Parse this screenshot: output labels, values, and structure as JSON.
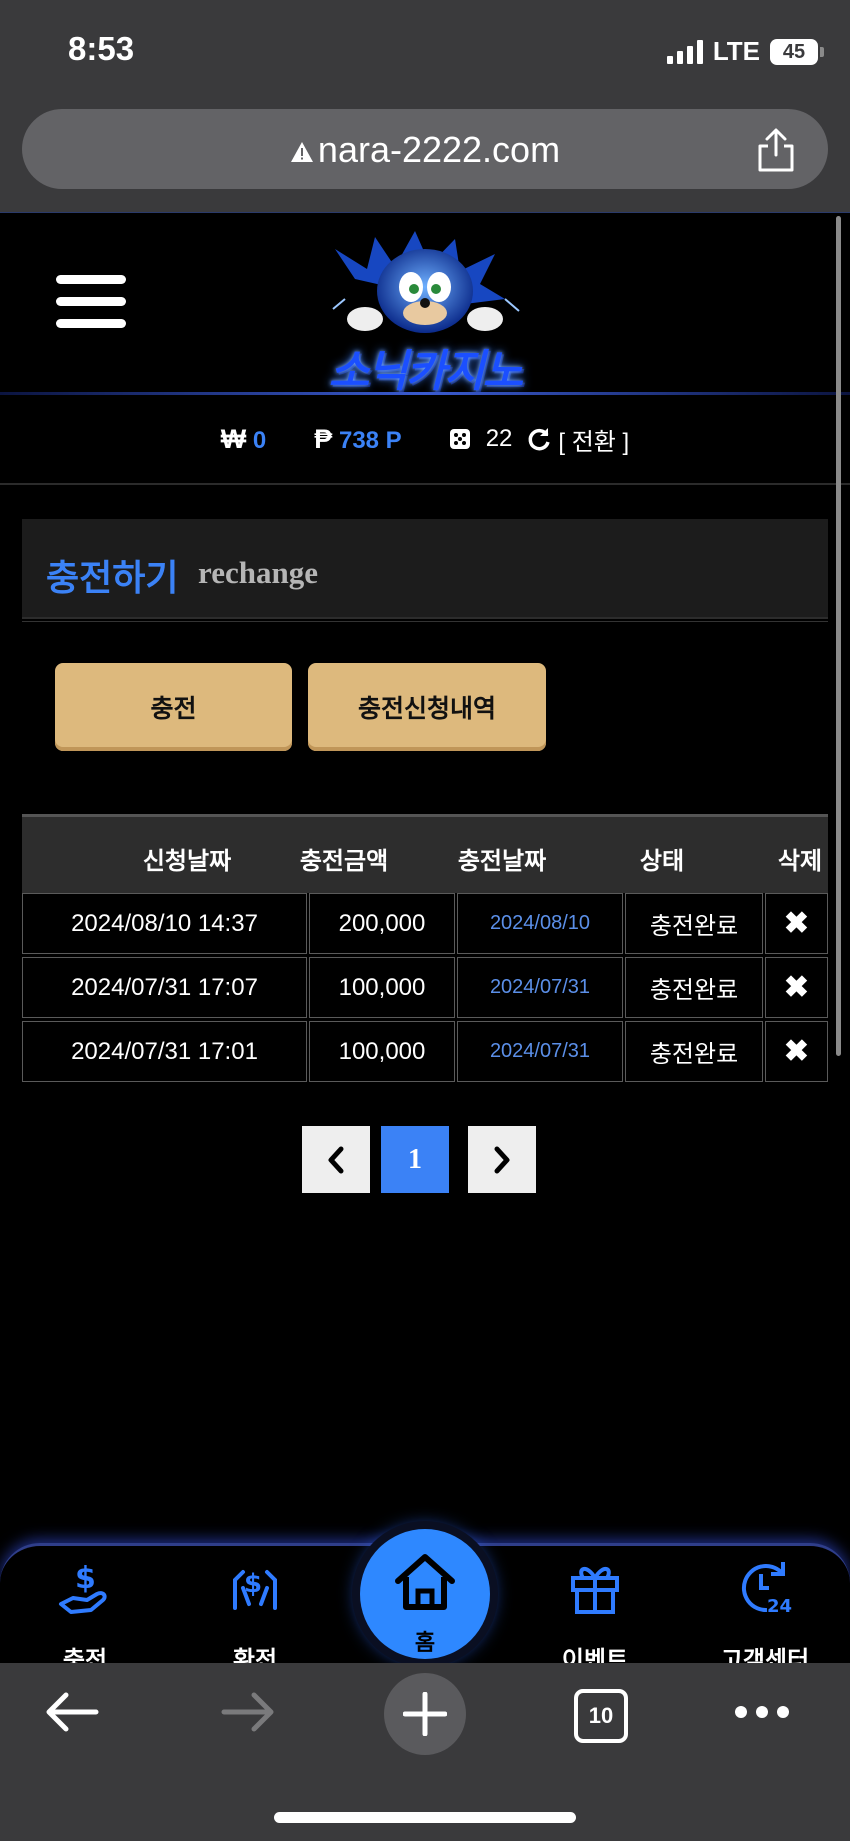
{
  "status": {
    "time": "8:53",
    "network": "LTE",
    "battery": "45",
    "battery_level": 0.45
  },
  "browser": {
    "url": "nara-2222.com",
    "tab_count": "10"
  },
  "site": {
    "logo_text": "소닉카지노"
  },
  "info": {
    "won_symbol": "₩",
    "won_value": "0",
    "point_symbol": "₱",
    "point_value": "738 P",
    "dice_value": "22",
    "switch_label": "[ 전환 ]"
  },
  "section": {
    "title": "충전하기",
    "subtitle": "rechange"
  },
  "buttons": {
    "charge": "충전",
    "history": "충전신청내역"
  },
  "table": {
    "headers": [
      "신청날짜",
      "충전금액",
      "충전날짜",
      "상태",
      "삭제"
    ],
    "rows": [
      {
        "requested": "2024/08/10 14:37",
        "amount": "200,000",
        "charged": "2024/08/10",
        "status": "충전완료",
        "delete": "✖"
      },
      {
        "requested": "2024/07/31 17:07",
        "amount": "100,000",
        "charged": "2024/07/31",
        "status": "충전완료",
        "delete": "✖"
      },
      {
        "requested": "2024/07/31 17:01",
        "amount": "100,000",
        "charged": "2024/07/31",
        "status": "충전완료",
        "delete": "✖"
      }
    ]
  },
  "pagination": {
    "prev": "‹",
    "current": "1",
    "next": "›"
  },
  "bottom_nav": {
    "charge": "충전",
    "exchange": "환전",
    "home": "홈",
    "event": "이벤트",
    "support": "고객센터"
  },
  "colors": {
    "accent": "#3b82f6",
    "button_gold": "#ddb97d",
    "header_bg": "#1c1c1c"
  }
}
